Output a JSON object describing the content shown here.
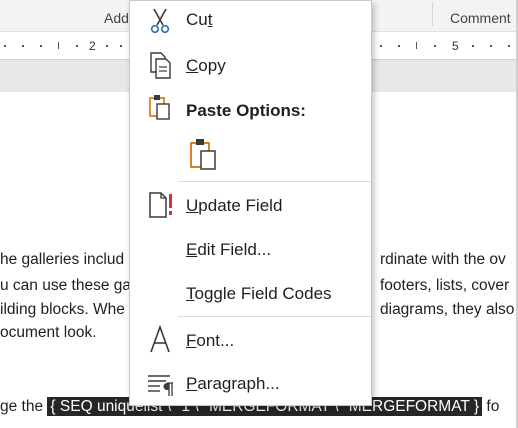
{
  "ribbon": {
    "left_label": "Add",
    "right_label": "Comment"
  },
  "ruler": {
    "left_number": "2",
    "right_number": "5"
  },
  "document": {
    "line1_left": "he galleries includ",
    "line1_right": "rdinate with the ov",
    "line2_left": "u can use these ga",
    "line2_right": "footers, lists, cover",
    "line3_left": "ilding blocks. Whe",
    "line3_right": "diagrams, they also",
    "line4_left": "ocument look.",
    "line5_prefix": "ge the",
    "field_code": "{ SEQ uniquelist \\* 1 \\* MERGEFORMAT \\* MERGEFORMAT }",
    "line5_suffix": "fo"
  },
  "menu": {
    "cut": {
      "prefix": "Cu",
      "accel": "t",
      "suffix": "",
      "icon": "scissors-icon"
    },
    "copy": {
      "prefix": "",
      "accel": "C",
      "suffix": "opy",
      "icon": "copy-icon"
    },
    "paste_options": {
      "label": "Paste Options:",
      "icon": "clipboard-icon"
    },
    "paste_keep": {
      "icon": "paste-keep-formatting-icon"
    },
    "update_field": {
      "prefix": "",
      "accel": "U",
      "suffix": "pdate Field",
      "icon": "update-field-icon"
    },
    "edit_field": {
      "prefix": "",
      "accel": "E",
      "suffix": "dit Field...",
      "icon": ""
    },
    "toggle_field_codes": {
      "prefix": "",
      "accel": "T",
      "suffix": "oggle Field Codes",
      "icon": ""
    },
    "font": {
      "prefix": "",
      "accel": "F",
      "suffix": "ont...",
      "icon": "font-icon"
    },
    "paragraph": {
      "prefix": "",
      "accel": "P",
      "suffix": "aragraph...",
      "icon": "paragraph-icon"
    }
  },
  "colors": {
    "accent_orange": "#d9730d",
    "alert_red": "#d13438",
    "scissors_blue": "#2b6cb0",
    "field_code_bg": "#262626"
  }
}
